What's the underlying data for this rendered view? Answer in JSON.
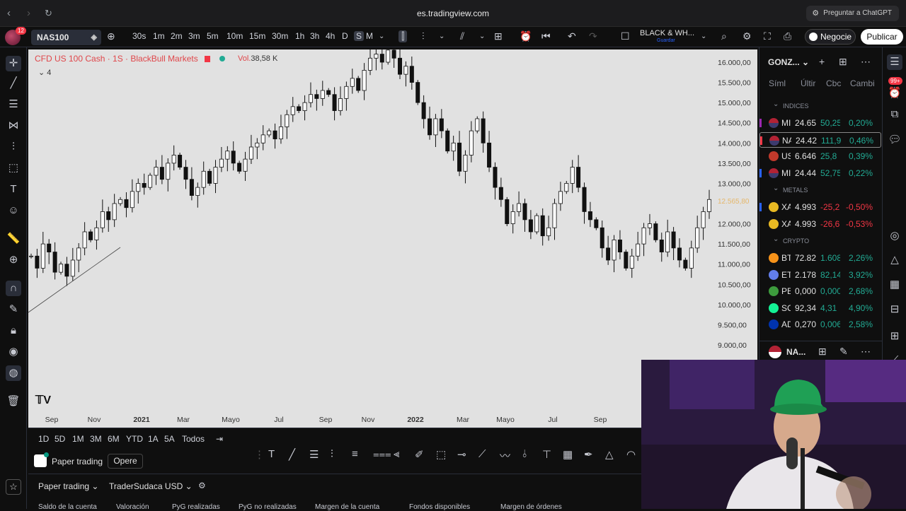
{
  "browser": {
    "url": "es.tradingview.com",
    "chatgpt_label": "Preguntar a ChatGPT"
  },
  "toolbar": {
    "avatar_badge": "12",
    "symbol": "NAS100",
    "intervals": [
      "30s",
      "1m",
      "2m",
      "3m",
      "5m",
      "10m",
      "15m",
      "30m",
      "1h",
      "3h",
      "4h",
      "D",
      "S",
      "M"
    ],
    "selected_interval": "S",
    "theme_label": "BLACK & WH...",
    "theme_sub": "Guardar",
    "trade_label": "Negocie",
    "publish_label": "Publicar"
  },
  "chart": {
    "title": "CFD US 100 Cash · 1S · BlackBull Markets",
    "vol_label": "Vol.",
    "vol_value": "38,58 K",
    "indicator_count": "4",
    "price_tag": "12.565,80",
    "y_ticks": [
      "16.000,00",
      "15.500,00",
      "15.000,00",
      "14.500,00",
      "14.000,00",
      "13.500,00",
      "13.000,00",
      "12.000,00",
      "11.500,00",
      "11.000,00",
      "10.500,00",
      "10.000,00",
      "9.500,00",
      "9.000,00"
    ],
    "x_ticks": [
      "Sep",
      "Nov",
      "2021",
      "Mar",
      "Mayo",
      "Jul",
      "Sep",
      "Nov",
      "2022",
      "Mar",
      "Mayo",
      "Jul",
      "Sep"
    ],
    "bold_x_ticks": [
      "2021",
      "2022"
    ]
  },
  "range": {
    "buttons": [
      "1D",
      "5D",
      "1M",
      "3M",
      "6M",
      "YTD",
      "1A",
      "5A",
      "Todos"
    ]
  },
  "paper": {
    "label": "Paper trading",
    "opere": "Opere"
  },
  "bottom": {
    "tab": "Paper trading",
    "account": "TraderSudaca USD",
    "columns": [
      "Saldo de la cuenta",
      "Valoración",
      "PyG realizadas",
      "PyG no realizadas",
      "Margen de la cuenta",
      "Fondos disponibles",
      "Margen de órdenes"
    ]
  },
  "watchlist": {
    "user": "GONZ...",
    "headers": [
      "Síml",
      "Últir",
      "Cbc",
      "Cambi"
    ],
    "sections": [
      {
        "name": "INDICES",
        "rows": [
          {
            "sym": "MI",
            "last": "24.65",
            "chg": "50,25",
            "pct": "0,20%",
            "dir": "up",
            "icon": "us-flag",
            "mark": "#9c27b0"
          },
          {
            "sym": "NA",
            "last": "24.42",
            "chg": "111,9",
            "pct": "0,46%",
            "dir": "up",
            "icon": "us-flag",
            "mark": "#f23645",
            "selected": true
          },
          {
            "sym": "US",
            "last": "6.646",
            "chg": "25,8",
            "pct": "0,39%",
            "dir": "up",
            "icon": "sp500",
            "mark": ""
          },
          {
            "sym": "MI",
            "last": "24.44",
            "chg": "52,75",
            "pct": "0,22%",
            "dir": "up",
            "icon": "us-flag",
            "mark": "#2962ff"
          }
        ]
      },
      {
        "name": "METALS",
        "rows": [
          {
            "sym": "XA",
            "last": "4.993",
            "chg": "-25,2",
            "pct": "-0,50%",
            "dir": "dn",
            "icon": "gold",
            "mark": "#2962ff"
          },
          {
            "sym": "XA",
            "last": "4.993",
            "chg": "-26,6",
            "pct": "-0,53%",
            "dir": "dn",
            "icon": "gold",
            "mark": ""
          }
        ]
      },
      {
        "name": "CRYPTO",
        "rows": [
          {
            "sym": "BT",
            "last": "72.82",
            "chg": "1.608",
            "pct": "2,26%",
            "dir": "up",
            "icon": "bitcoin",
            "mark": ""
          },
          {
            "sym": "ET",
            "last": "2.178",
            "chg": "82,14",
            "pct": "3,92%",
            "dir": "up",
            "icon": "ethereum",
            "mark": ""
          },
          {
            "sym": "PE",
            "last": "0,000",
            "chg": "0,000",
            "pct": "2,68%",
            "dir": "up",
            "icon": "pepe",
            "mark": ""
          },
          {
            "sym": "SC",
            "last": "92,34",
            "chg": "4,31",
            "pct": "4,90%",
            "dir": "up",
            "icon": "solana",
            "mark": ""
          },
          {
            "sym": "AD",
            "last": "0,270",
            "chg": "0,006",
            "pct": "2,58%",
            "dir": "up",
            "icon": "cardano",
            "mark": ""
          }
        ]
      }
    ],
    "footer_symbol": "NA..."
  },
  "right_badge": "99+",
  "colors": {
    "up": "#22ab94",
    "down": "#f23645",
    "accent": "#2962ff",
    "chart_bg": "#e1e1e1"
  }
}
